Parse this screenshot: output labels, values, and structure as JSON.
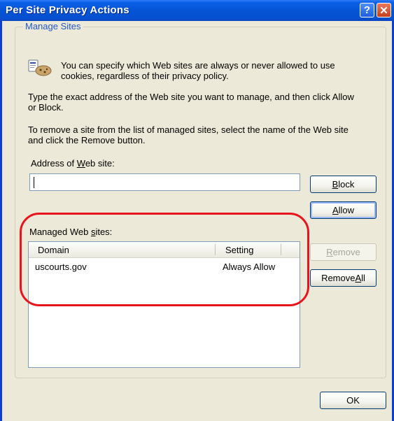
{
  "window": {
    "title": "Per Site Privacy Actions",
    "help_glyph": "?",
    "close_glyph": "✕"
  },
  "group": {
    "legend": "Manage Sites"
  },
  "text": {
    "intro_line1": "You can specify which Web sites are always or never allowed to use",
    "intro_line2": "cookies, regardless of their privacy policy.",
    "type_line1": "Type the exact address of the Web site you want to manage, and then click Allow",
    "type_line2": "or Block.",
    "remove_line1": "To remove a site from the list of managed sites, select the name of the Web site",
    "remove_line2": "and click the Remove button.",
    "address_label_pre": "Address of ",
    "address_label_key": "W",
    "address_label_post": "eb site:",
    "managed_label_pre": "Managed Web ",
    "managed_label_key": "s",
    "managed_label_post": "ites:"
  },
  "address_input": {
    "value": ""
  },
  "buttons": {
    "block_key": "B",
    "block_rest": "lock",
    "allow_key": "A",
    "allow_rest": "llow",
    "remove_key": "R",
    "remove_rest": "emove",
    "remove_all_pre": "Remove ",
    "remove_all_key": "A",
    "remove_all_post": "ll",
    "ok": "OK"
  },
  "list": {
    "columns": [
      "Domain",
      "Setting"
    ],
    "rows": [
      {
        "domain": "uscourts.gov",
        "setting": "Always Allow"
      }
    ]
  },
  "colors": {
    "title_blue": "#0554d6",
    "dialog_bg": "#ece9d8",
    "group_legend": "#2456c7",
    "annotation_red": "#e8141d"
  }
}
